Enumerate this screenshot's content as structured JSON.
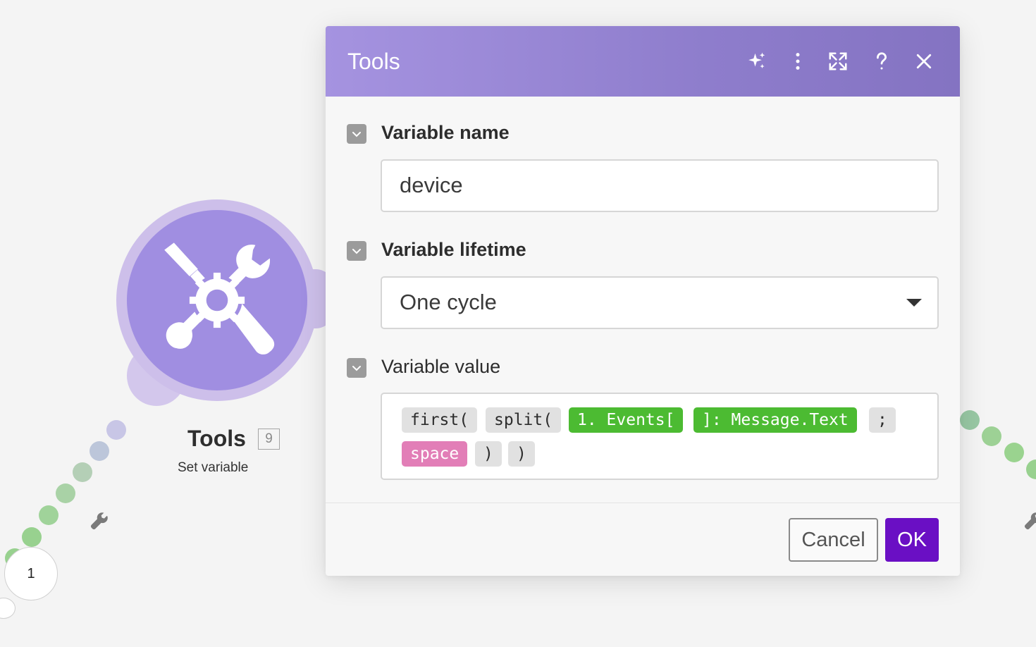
{
  "dialog": {
    "title": "Tools",
    "header_icons": [
      "sparkle-icon",
      "more-vertical-icon",
      "expand-icon",
      "help-icon",
      "close-icon"
    ],
    "fields": {
      "variable_name": {
        "label": "Variable name",
        "value": "device"
      },
      "variable_lifetime": {
        "label": "Variable lifetime",
        "value": "One cycle"
      },
      "variable_value": {
        "label": "Variable value",
        "tokens": [
          {
            "text": "first(",
            "kind": "function"
          },
          {
            "text": "split(",
            "kind": "function"
          },
          {
            "text": "1. Events[",
            "kind": "variable"
          },
          {
            "text": "]: Message.Text",
            "kind": "variable"
          },
          {
            "text": ";",
            "kind": "function"
          },
          {
            "text": "space",
            "kind": "keyword"
          },
          {
            "text": ")",
            "kind": "function"
          },
          {
            "text": ")",
            "kind": "function"
          }
        ]
      }
    },
    "buttons": {
      "cancel": "Cancel",
      "ok": "OK"
    }
  },
  "module": {
    "title": "Tools",
    "id": "9",
    "subtitle": "Set variable",
    "icon": "tools-icon"
  },
  "route_node": {
    "label": "1"
  },
  "colors": {
    "header_start": "#a593e0",
    "header_end": "#8473c2",
    "module_fill": "#a08ee1",
    "ok_button": "#6a0fc4",
    "variable_pill": "#4cbb32",
    "keyword_pill": "#e27eb7"
  }
}
